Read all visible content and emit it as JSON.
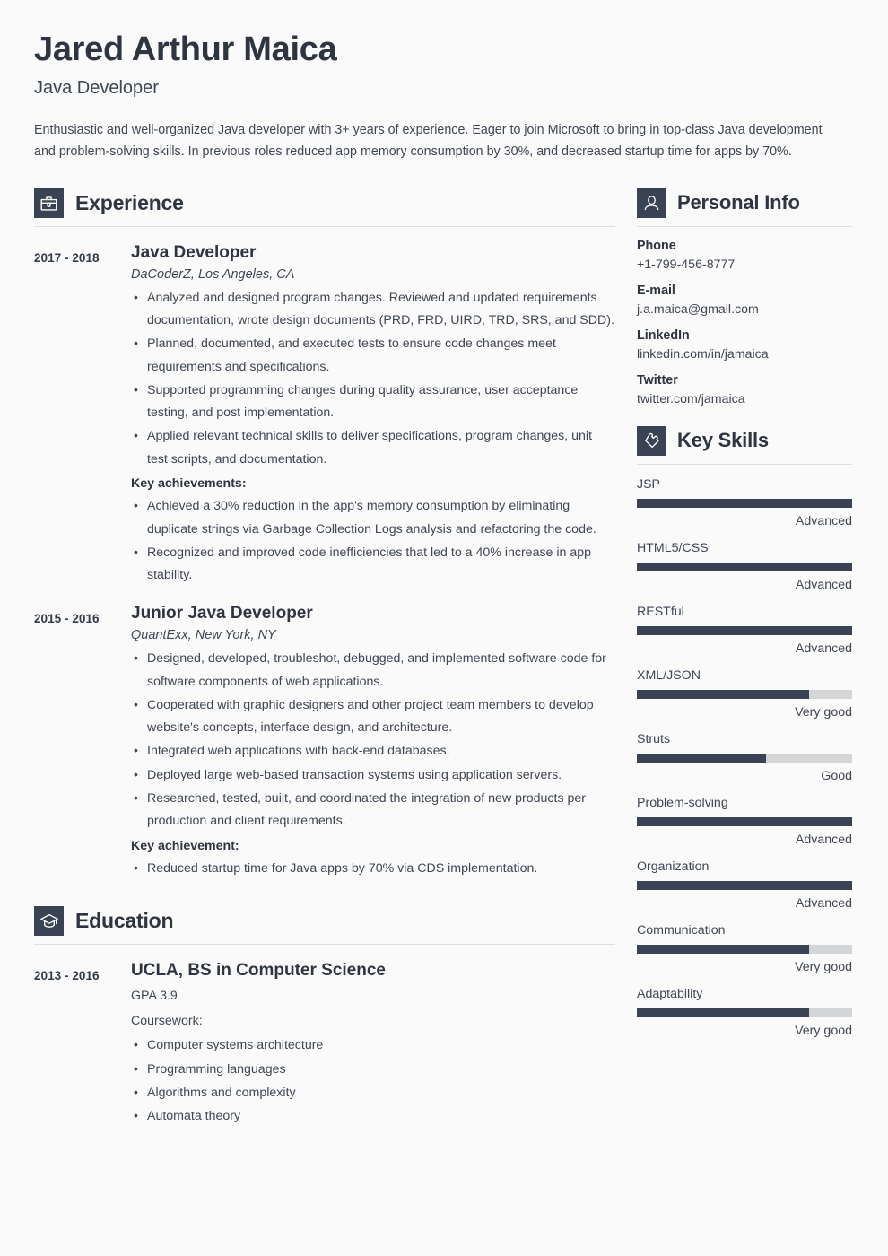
{
  "colors": {
    "background": "#fafafa",
    "accent_dark": "#3a4354",
    "text": "#3f4654",
    "heading": "#2e3440",
    "rule": "#dcdfe3",
    "track": "#d3d5d6"
  },
  "header": {
    "name": "Jared Arthur Maica",
    "job_title": "Java Developer",
    "summary": "Enthusiastic and well-organized Java developer with 3+ years of experience. Eager to join Microsoft to bring in top-class Java development and problem-solving skills. In previous roles reduced app memory consumption by 30%, and decreased startup time for apps by 70%."
  },
  "experience": {
    "icon": "briefcase-icon",
    "title": "Experience",
    "entries": [
      {
        "dates": "2017 - 2018",
        "role": "Java Developer",
        "company": "DaCoderZ, Los Angeles, CA",
        "bullets": [
          "Analyzed and designed program changes. Reviewed and updated requirements documentation, wrote design documents (PRD, FRD, UIRD, TRD, SRS, and SDD).",
          "Planned, documented, and executed tests to ensure code changes meet requirements and specifications.",
          "Supported programming changes during quality assurance, user acceptance testing, and post implementation.",
          "Applied relevant technical skills to deliver specifications, program changes, unit test scripts, and documentation."
        ],
        "achievements_label": "Key achievements:",
        "achievements": [
          "Achieved a 30% reduction in the app's memory consumption by eliminating duplicate strings via Garbage Collection Logs analysis and refactoring the code.",
          "Recognized and improved code inefficiencies that led to a 40% increase in app stability."
        ]
      },
      {
        "dates": "2015 - 2016",
        "role": "Junior Java Developer",
        "company": "QuantExx, New York, NY",
        "bullets": [
          "Designed, developed, troubleshot, debugged, and implemented software code for software components of web applications.",
          "Cooperated with graphic designers and other project team members to develop website's concepts, interface design, and architecture.",
          "Integrated web applications with back-end databases.",
          "Deployed large web-based transaction systems using application servers.",
          "Researched, tested, built, and coordinated the integration of new products per production and client requirements."
        ],
        "achievements_label": "Key achievement:",
        "achievements": [
          "Reduced startup time for Java apps by 70% via CDS implementation."
        ]
      }
    ]
  },
  "education": {
    "icon": "graduation-cap-icon",
    "title": "Education",
    "entries": [
      {
        "dates": "2013 - 2016",
        "school": "UCLA, BS in Computer Science",
        "gpa": "GPA 3.9",
        "coursework_label": "Coursework:",
        "coursework": [
          "Computer systems architecture",
          "Programming languages",
          "Algorithms and complexity",
          "Automata theory"
        ]
      }
    ]
  },
  "personal_info": {
    "icon": "person-icon",
    "title": "Personal Info",
    "items": [
      {
        "label": "Phone",
        "value": "+1-799-456-8777"
      },
      {
        "label": "E-mail",
        "value": "j.a.maica@gmail.com"
      },
      {
        "label": "LinkedIn",
        "value": "linkedin.com/in/jamaica"
      },
      {
        "label": "Twitter",
        "value": "twitter.com/jamaica"
      }
    ]
  },
  "key_skills": {
    "icon": "puzzle-piece-icon",
    "title": "Key Skills",
    "items": [
      {
        "name": "JSP",
        "level": "Advanced",
        "percent": 100
      },
      {
        "name": "HTML5/CSS",
        "level": "Advanced",
        "percent": 100
      },
      {
        "name": "RESTful",
        "level": "Advanced",
        "percent": 100
      },
      {
        "name": "XML/JSON",
        "level": "Very good",
        "percent": 80
      },
      {
        "name": "Struts",
        "level": "Good",
        "percent": 60
      },
      {
        "name": "Problem-solving",
        "level": "Advanced",
        "percent": 100
      },
      {
        "name": "Organization",
        "level": "Advanced",
        "percent": 100
      },
      {
        "name": "Communication",
        "level": "Very good",
        "percent": 80
      },
      {
        "name": "Adaptability",
        "level": "Very good",
        "percent": 80
      }
    ]
  }
}
